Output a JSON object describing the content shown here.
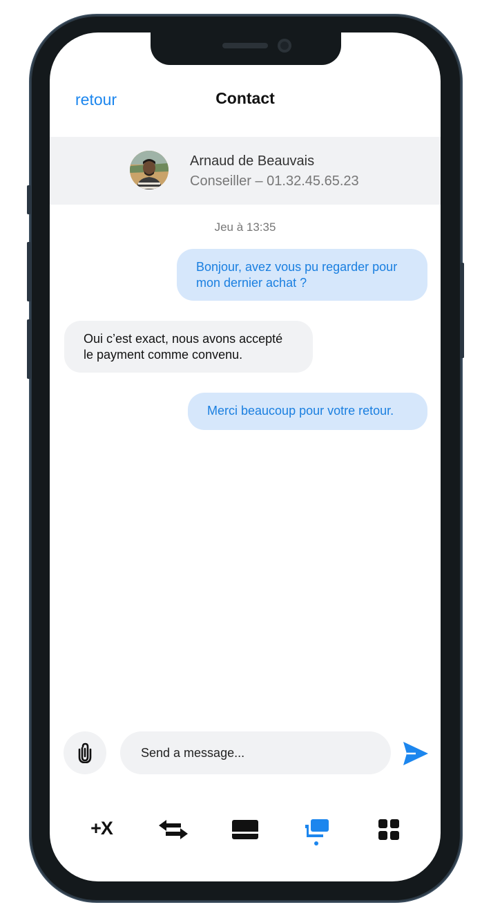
{
  "header": {
    "back_label": "retour",
    "title": "Contact"
  },
  "contact": {
    "name": "Arnaud de Beauvais",
    "subtitle": "Conseiller – 01.32.45.65.23"
  },
  "conversation": {
    "timestamp": "Jeu à 13:35",
    "messages": [
      {
        "direction": "outgoing",
        "lines": [
          "Bonjour, avez vous pu regarder pour",
          "mon dernier achat ?"
        ]
      },
      {
        "direction": "incoming",
        "lines": [
          "Oui c’est exact, nous avons accepté",
          "le payment comme convenu."
        ]
      },
      {
        "direction": "outgoing",
        "lines": [
          "Merci beaucoup pour votre retour."
        ]
      }
    ]
  },
  "composer": {
    "placeholder": "Send a message...",
    "attach_icon": "paperclip-icon",
    "send_icon": "send-icon"
  },
  "tabbar": {
    "items": [
      {
        "label": "+X",
        "icon": "plus-x-icon",
        "active": false
      },
      {
        "icon": "transfer-arrows-icon",
        "active": false
      },
      {
        "icon": "card-icon",
        "active": false
      },
      {
        "icon": "chat-cart-icon",
        "active": true
      },
      {
        "icon": "grid-icon",
        "active": false
      }
    ]
  },
  "colors": {
    "accent": "#1c86ee",
    "bubble_outgoing": "#d6e7fb",
    "bubble_incoming": "#f1f2f4",
    "frame": "#14191c"
  }
}
